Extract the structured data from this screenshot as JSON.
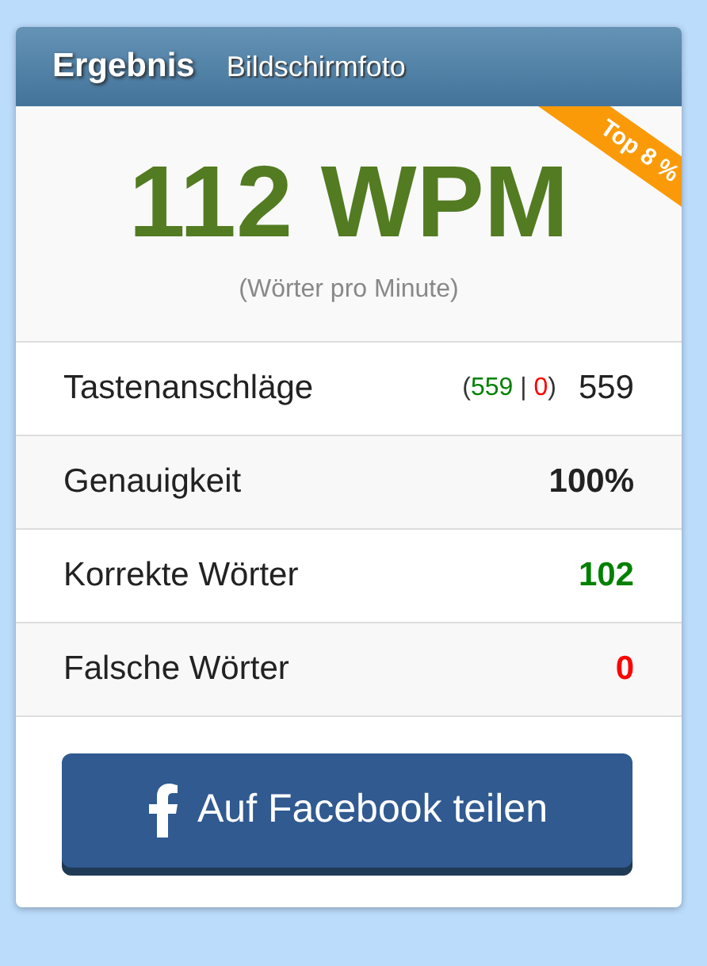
{
  "tabs": [
    {
      "label": "Ergebnis",
      "selected": true
    },
    {
      "label": "Bildschirmfoto",
      "selected": false
    }
  ],
  "result": {
    "speed": "112 WPM",
    "unit_note": "(Wörter pro Minute)",
    "rank_badge": "Top 8 %"
  },
  "stats": [
    {
      "kind": "breakdown",
      "label": "Tastenanschläge",
      "open": "(",
      "correct": "559",
      "separator": "|",
      "wrong": "0",
      "close": ")",
      "value": "559"
    },
    {
      "kind": "bold",
      "label": "Genauigkeit",
      "value": "100%"
    },
    {
      "kind": "correct",
      "label": "Korrekte Wörter",
      "value": "102"
    },
    {
      "kind": "wrong",
      "label": "Falsche Wörter",
      "value": "0"
    }
  ],
  "share_button": {
    "label": "Auf Facebook teilen"
  }
}
